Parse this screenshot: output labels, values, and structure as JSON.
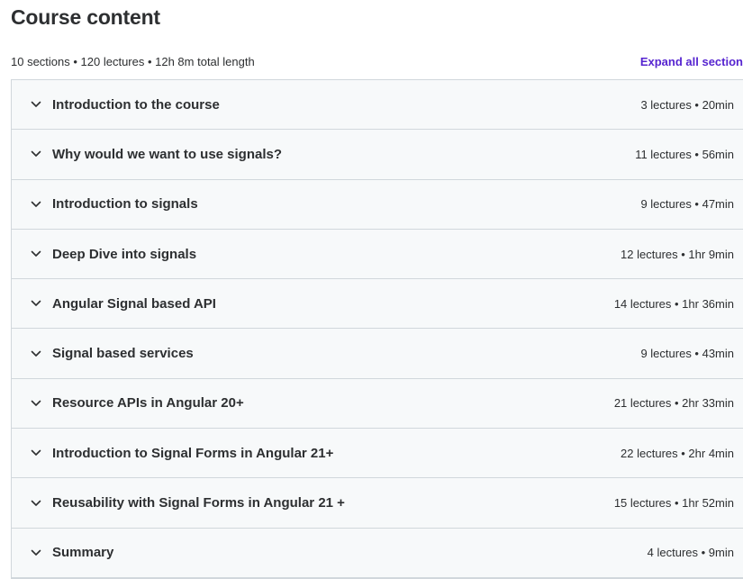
{
  "header": {
    "title": "Course content",
    "summary": "10 sections • 120 lectures • 12h 8m total length",
    "expand_all_label": "Expand all section"
  },
  "colors": {
    "accent": "#5624d0",
    "row_background": "#f7f9fa",
    "border": "#d1d7dc",
    "text": "#2d2f31"
  },
  "sections": [
    {
      "title": "Introduction to the course",
      "stats": "3 lectures • 20min"
    },
    {
      "title": "Why would we want to use signals?",
      "stats": "11 lectures • 56min"
    },
    {
      "title": "Introduction to signals",
      "stats": "9 lectures • 47min"
    },
    {
      "title": "Deep Dive into signals",
      "stats": "12 lectures • 1hr 9min"
    },
    {
      "title": "Angular Signal based API",
      "stats": "14 lectures • 1hr 36min"
    },
    {
      "title": "Signal based services",
      "stats": "9 lectures • 43min"
    },
    {
      "title": "Resource APIs in Angular 20+",
      "stats": "21 lectures • 2hr 33min"
    },
    {
      "title": "Introduction to Signal Forms in Angular 21+",
      "stats": "22 lectures • 2hr 4min"
    },
    {
      "title": "Reusability with Signal Forms in Angular 21 +",
      "stats": "15 lectures • 1hr 52min"
    },
    {
      "title": "Summary",
      "stats": "4 lectures • 9min"
    }
  ]
}
